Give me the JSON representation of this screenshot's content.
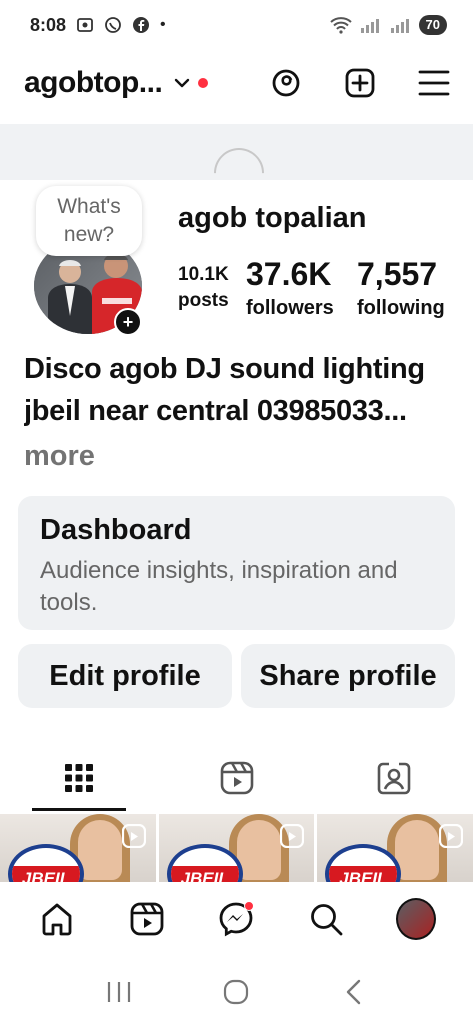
{
  "status_bar": {
    "time": "8:08",
    "battery": "70",
    "dot": "•"
  },
  "header": {
    "username": "agobtop...",
    "icons": [
      "chevron-down-icon",
      "threads-icon",
      "new-post-icon",
      "menu-icon"
    ]
  },
  "profile": {
    "whats_new_line1": "What's",
    "whats_new_line2": "new?",
    "name": "agob topalian",
    "posts": {
      "value": "10.1K",
      "label": "posts"
    },
    "followers": {
      "value": "37.6K",
      "label": "followers"
    },
    "following": {
      "value": "7,557",
      "label": "following"
    },
    "bio_line1": "Disco agob DJ sound lighting",
    "bio_line2": "jbeil near central 03985033...",
    "more": "more",
    "add_story": "+"
  },
  "dashboard": {
    "title": "Dashboard",
    "subtitle": "Audience insights, inspiration and tools."
  },
  "buttons": {
    "edit": "Edit profile",
    "share": "Share profile"
  },
  "tabs": [
    "grid-icon",
    "reels-icon",
    "tagged-icon"
  ],
  "grid": [
    {
      "logo_text": "JBEIL"
    },
    {
      "logo_text": "JBEIL"
    },
    {
      "logo_text": "JBEIL"
    }
  ],
  "bottom_nav": [
    "home-icon",
    "reels-icon",
    "messenger-icon",
    "search-icon",
    "profile-avatar"
  ],
  "colors": {
    "accent_red": "#ff3040",
    "card_bg": "#eff1f3",
    "muted_text": "#737373"
  }
}
